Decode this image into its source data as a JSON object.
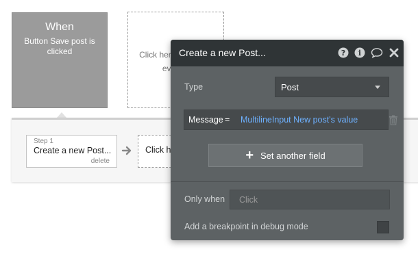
{
  "trigger": {
    "heading": "When",
    "description": "Button Save post is clicked"
  },
  "add_event": {
    "label": "Click here to add an event..."
  },
  "workflow": {
    "step": {
      "number_label": "Step 1",
      "title": "Create a new Post...",
      "delete_label": "delete"
    },
    "add_action_label": "Click here to add an action..."
  },
  "panel": {
    "title": "Create a new Post...",
    "header_icons": [
      "question-icon",
      "info-icon",
      "comment-icon",
      "close-icon"
    ],
    "type_label": "Type",
    "type_value": "Post",
    "field": {
      "key": "Message",
      "operator": "=",
      "value": "MultilineInput New post's value"
    },
    "set_field_label": "Set another field",
    "only_when_label": "Only when",
    "only_when_placeholder": "Click",
    "breakpoint_label": "Add a breakpoint in debug mode",
    "breakpoint_checked": false
  },
  "colors": {
    "panel_bg": "#5d6264",
    "panel_header": "#2f3436",
    "dynamic_text": "#6eb1ff",
    "trigger_bg": "#9b9b9b"
  }
}
